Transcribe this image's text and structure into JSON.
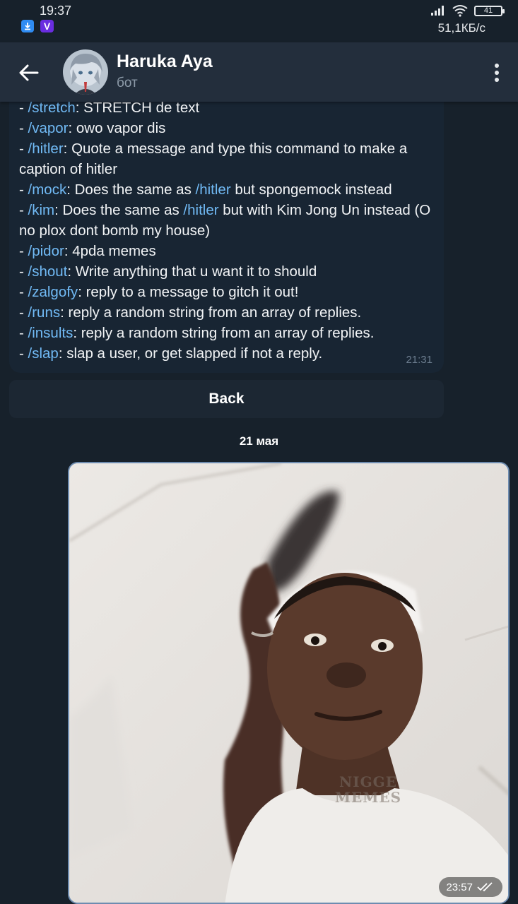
{
  "status_bar": {
    "time": "19:37",
    "battery": "41",
    "speed": "51,1КБ/с"
  },
  "header": {
    "title": "Haruka Aya",
    "subtitle": "бот",
    "back_icon": "arrow-left-icon",
    "menu_icon": "more-vertical-icon"
  },
  "message": {
    "lines": [
      {
        "cmd": "/stretch",
        "text": ": STRETCH de text"
      },
      {
        "cmd": "/vapor",
        "text": ": owo vapor dis"
      },
      {
        "cmd": "/hitler",
        "text": ": Quote a message and type this command to make a caption of hitler"
      },
      {
        "cmd": "/mock",
        "text": ": Does the same as ",
        "cmd2": "/hitler",
        "text2": " but spongemock instead"
      },
      {
        "cmd": "/kim",
        "text": ": Does the same as ",
        "cmd2": "/hitler",
        "text2": " but with Kim Jong Un instead (O no plox dont bomb my house)"
      },
      {
        "cmd": "/pidor",
        "text": ": 4pda memes"
      },
      {
        "cmd": "/shout",
        "text": ": Write anything that u want it to should"
      },
      {
        "cmd": "/zalgofy",
        "text": ": reply to a message to gitch it out!"
      },
      {
        "cmd": "/runs",
        "text": ": reply a random string from an array of replies."
      },
      {
        "cmd": "/insults",
        "text": ": reply a random string from an array of replies."
      },
      {
        "cmd": "/slap",
        "text": ": slap a user, or get slapped if not a reply."
      }
    ],
    "time": "21:31"
  },
  "keyboard": {
    "back_label": "Back"
  },
  "date_separator": "21 мая",
  "photo_message": {
    "watermark": "NIGGE MEMES",
    "time": "23:57",
    "read_icon": "double-check-icon"
  },
  "colors": {
    "background": "#17212b",
    "header": "#232e3c",
    "bubble": "#182533",
    "link": "#71baf5"
  }
}
